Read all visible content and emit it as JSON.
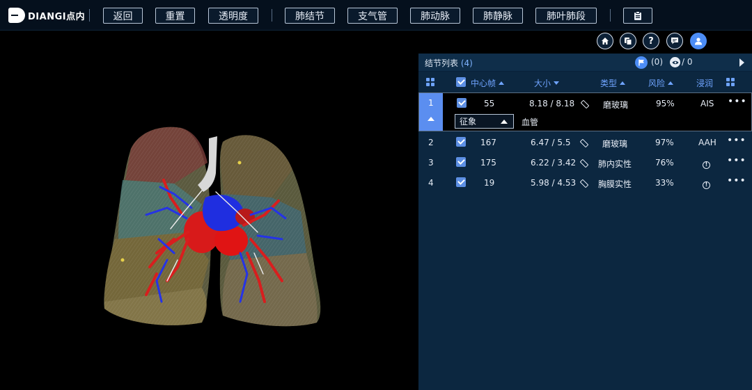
{
  "toolbar": {
    "logo_text": "DIANGI点内",
    "buttons": [
      "返回",
      "重置",
      "透明度",
      "肺结节",
      "支气管",
      "肺动脉",
      "肺静脉",
      "肺叶肺段"
    ],
    "extra_icon": "clipboard-icon"
  },
  "round_buttons": [
    "home-icon",
    "copy-icon",
    "help-icon",
    "message-icon",
    "user-icon"
  ],
  "panel": {
    "title": "结节列表",
    "count": "(4)",
    "flag_count": "(0)",
    "eye_count": "/ 0",
    "columns": {
      "center_frame": "中心帧",
      "size": "大小",
      "type": "类型",
      "risk": "风险",
      "infiltration": "浸润"
    },
    "rows": [
      {
        "index": "1",
        "frame": "55",
        "size": "8.18 / 8.18",
        "type": "磨玻璃",
        "risk": "95%",
        "infiltration": "AIS",
        "selected": true
      },
      {
        "index": "2",
        "frame": "167",
        "size": "6.47 / 5.5",
        "type": "磨玻璃",
        "risk": "97%",
        "infiltration": "AAH"
      },
      {
        "index": "3",
        "frame": "175",
        "size": "6.22 / 3.42",
        "type": "肺内实性",
        "risk": "76%",
        "infiltration": "info-icon"
      },
      {
        "index": "4",
        "frame": "19",
        "size": "5.98 / 4.53",
        "type": "胸膜实性",
        "risk": "33%",
        "infiltration": "info-icon"
      }
    ],
    "feature": {
      "dropdown_label": "征象",
      "value": "血管"
    },
    "more_label": "•••"
  },
  "colors": {
    "accent": "#4c8df6",
    "panel_bg": "#0c2740",
    "toolbar_bg": "#05101d"
  }
}
